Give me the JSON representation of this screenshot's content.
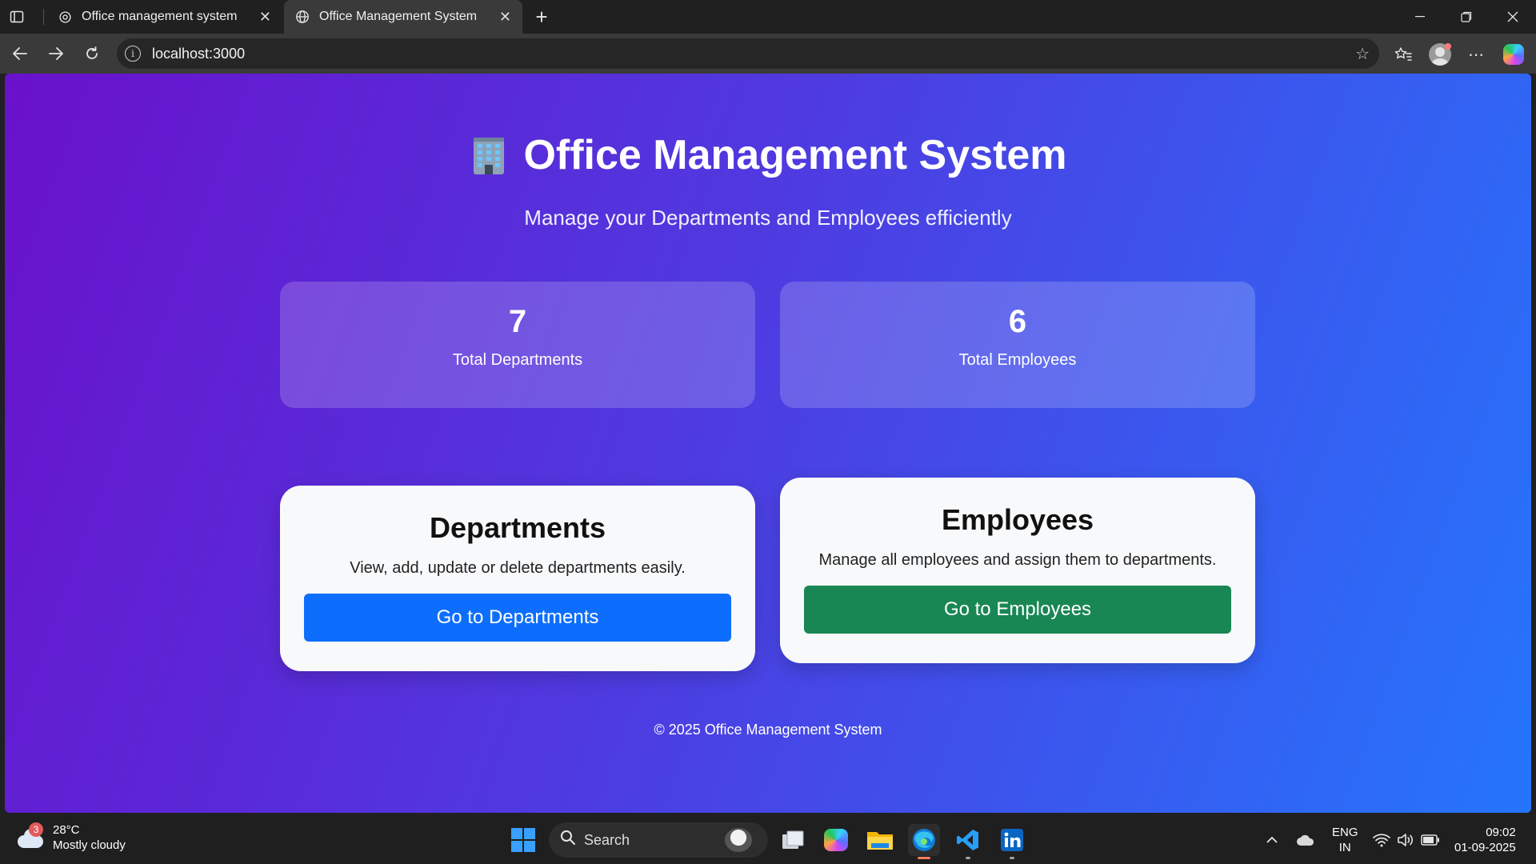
{
  "browser": {
    "tabs": [
      {
        "title": "Office management system",
        "active": false
      },
      {
        "title": "Office Management System",
        "active": true
      }
    ],
    "url": "localhost:3000"
  },
  "page": {
    "title": "Office Management System",
    "subtitle": "Manage your Departments and Employees efficiently",
    "stats": [
      {
        "value": "7",
        "label": "Total Departments"
      },
      {
        "value": "6",
        "label": "Total Employees"
      }
    ],
    "cards": [
      {
        "heading": "Departments",
        "description": "View, add, update or delete departments easily.",
        "button": "Go to Departments"
      },
      {
        "heading": "Employees",
        "description": "Manage all employees and assign them to departments.",
        "button": "Go to Employees"
      }
    ],
    "footer": "© 2025 Office Management System"
  },
  "taskbar": {
    "weather": {
      "temp": "28°C",
      "condition": "Mostly cloudy",
      "badge": "3"
    },
    "search_label": "Search",
    "language": {
      "line1": "ENG",
      "line2": "IN"
    },
    "time": "09:02",
    "date": "01-09-2025"
  },
  "colors": {
    "gradient_start": "#6a11cb",
    "gradient_end": "#2575fc",
    "departments_button": "#0d6efd",
    "employees_button": "#198754"
  }
}
